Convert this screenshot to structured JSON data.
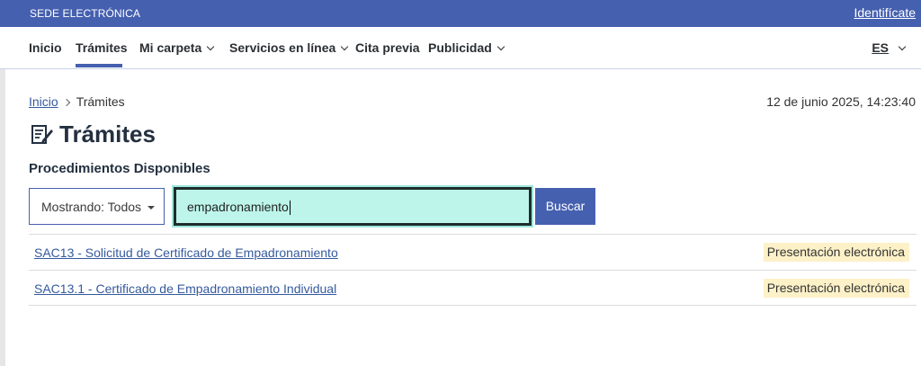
{
  "topbar": {
    "brand": "SEDE ELECTRÓNICA",
    "login": "Identifícate"
  },
  "nav": {
    "items": [
      {
        "label": "Inicio"
      },
      {
        "label": "Trámites"
      },
      {
        "label": "Mi carpeta"
      },
      {
        "label": "Servicios en línea"
      },
      {
        "label": "Cita previa"
      },
      {
        "label": "Publicidad"
      }
    ],
    "active": "Trámites",
    "language": "ES"
  },
  "breadcrumb": {
    "home": "Inicio",
    "current": "Trámites"
  },
  "datetime": "12 de junio 2025, 14:23:40",
  "page": {
    "title": "Trámites",
    "subtitle": "Procedimientos Disponibles"
  },
  "filter": {
    "label": "Mostrando: Todos"
  },
  "search": {
    "value": "empadronamiento",
    "button": "Buscar"
  },
  "results": [
    {
      "title": "SAC13 - Solicitud de Certificado de Empadronamiento",
      "badge": "Presentación electrónica"
    },
    {
      "title": "SAC13.1 - Certificado de Empadronamiento Individual",
      "badge": "Presentación electrónica"
    }
  ],
  "colors": {
    "primary": "#4660b0",
    "search_bg": "#bdf5ea",
    "badge_bg": "#fdf1c8",
    "link": "#355a9e"
  },
  "icons": {
    "page_title": "document-edit-icon"
  }
}
